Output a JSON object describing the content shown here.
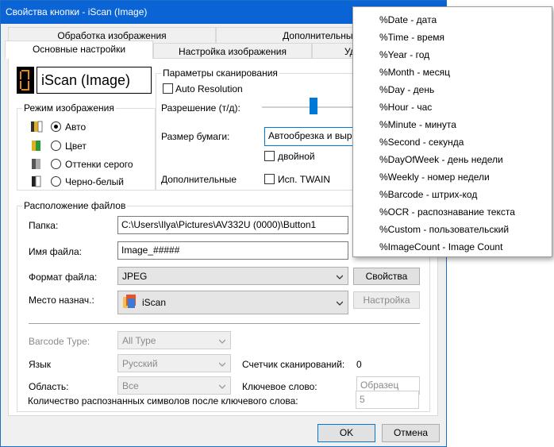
{
  "window": {
    "title": "Свойства кнопки - iScan (Image)"
  },
  "tabs": {
    "row_top": [
      "Обработка изображения",
      "Дополнительные на"
    ],
    "row_bottom": [
      "Основные настройки",
      "Настройка изображения",
      "Уд"
    ]
  },
  "app_name": "iScan (Image)",
  "image_mode": {
    "caption": "Режим изображения",
    "options": [
      "Авто",
      "Цвет",
      "Оттенки серого",
      "Черно-белый"
    ],
    "selected": "Авто"
  },
  "scan_params": {
    "caption": "Параметры сканирования",
    "auto_resolution": "Auto Resolution",
    "resolution_label": "Разрешение (т/д):",
    "paper_label": "Размер бумаги:",
    "paper_value": "Автообрезка и вырав",
    "duplex": "двойной",
    "extra_label": "Дополнительные",
    "twain": "Исп.  TWAIN"
  },
  "file_location": {
    "caption": "Расположение файлов",
    "folder_label": "Папка:",
    "folder_value": "C:\\Users\\Ilya\\Pictures\\AV332U (0000)\\Button1",
    "filename_label": "Имя файла:",
    "filename_value": "Image_#####",
    "format_label": "Формат файла:",
    "format_value": "JPEG",
    "properties_button": "Свойства",
    "dest_label": "Место назнач.:",
    "dest_value": "iScan",
    "settings_button": "Настройка"
  },
  "ocr": {
    "barcode_label": "Barcode Type:",
    "barcode_value": "All Type",
    "lang_label": "Язык",
    "lang_value": "Русский",
    "counter_label": "Счетчик сканирований:",
    "counter_value": "0",
    "area_label": "Область:",
    "area_value": "Все",
    "keyword_label": "Ключевое слово:",
    "keyword_placeholder": "Образец",
    "chars_label": "Количество распознанных символов после ключевого слова:",
    "chars_value": "5"
  },
  "footer": {
    "ok": "OK",
    "cancel": "Отмена"
  },
  "popup_menu": [
    "%Date - дата",
    "%Time - время",
    "%Year - год",
    "%Month - месяц",
    "%Day - день",
    "%Hour - час",
    "%Minute - минута",
    "%Second - секунда",
    "%DayOfWeek - день недели",
    "%Weekly - номер недели",
    "%Barcode - штрих-код",
    "%OCR - распознавание текста",
    "%Custom - пользовательский",
    "%ImageCount - Image Count"
  ],
  "colors": {
    "titlebar": "#0a64d6",
    "slider_thumb": "#0078d7"
  }
}
